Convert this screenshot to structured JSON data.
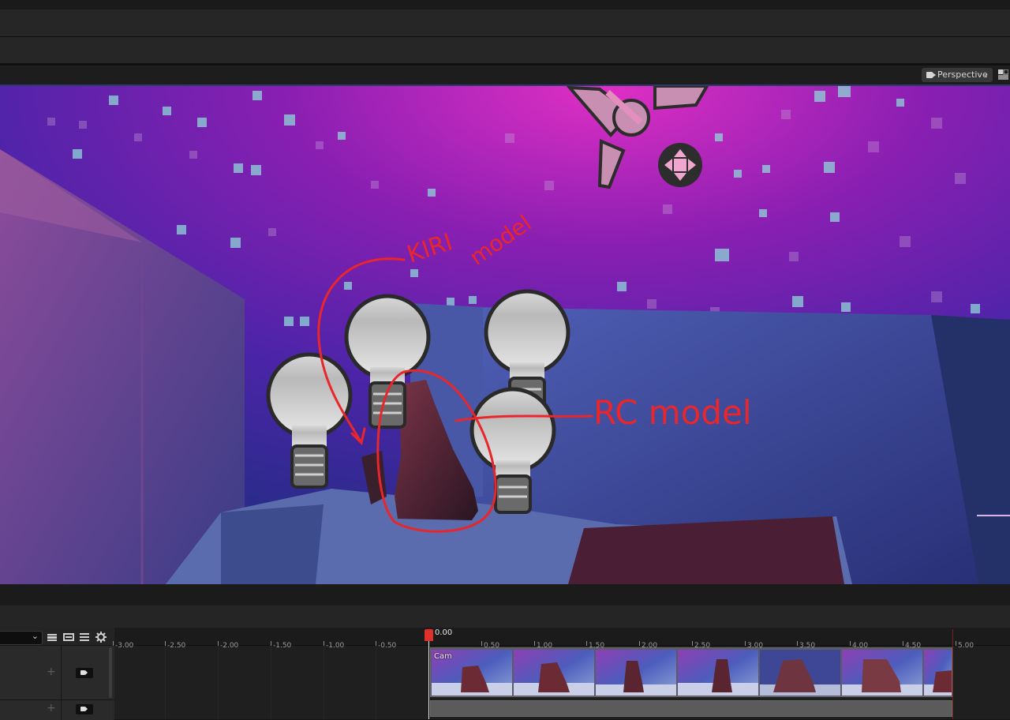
{
  "viewport_header": {
    "view_mode_label": "Perspective"
  },
  "annotations": {
    "kiri_label": "KIRI",
    "kiri_sub_label": "model",
    "rc_label": "RC model"
  },
  "sequencer": {
    "time_ticks": [
      "-3.00",
      "-2.50",
      "-2.00",
      "-1.50",
      "-1.00",
      "-0.50",
      "0.50",
      "1.00",
      "1.50",
      "2.00",
      "2.50",
      "3.00",
      "3.50",
      "4.00",
      "4.50",
      "5.00"
    ],
    "current_time": "0.00",
    "camera_clip_label": "Cam"
  },
  "colors": {
    "playhead": "#e0302c",
    "annotation_red": "#e8262b",
    "panel_bg": "#1e1e1e"
  }
}
